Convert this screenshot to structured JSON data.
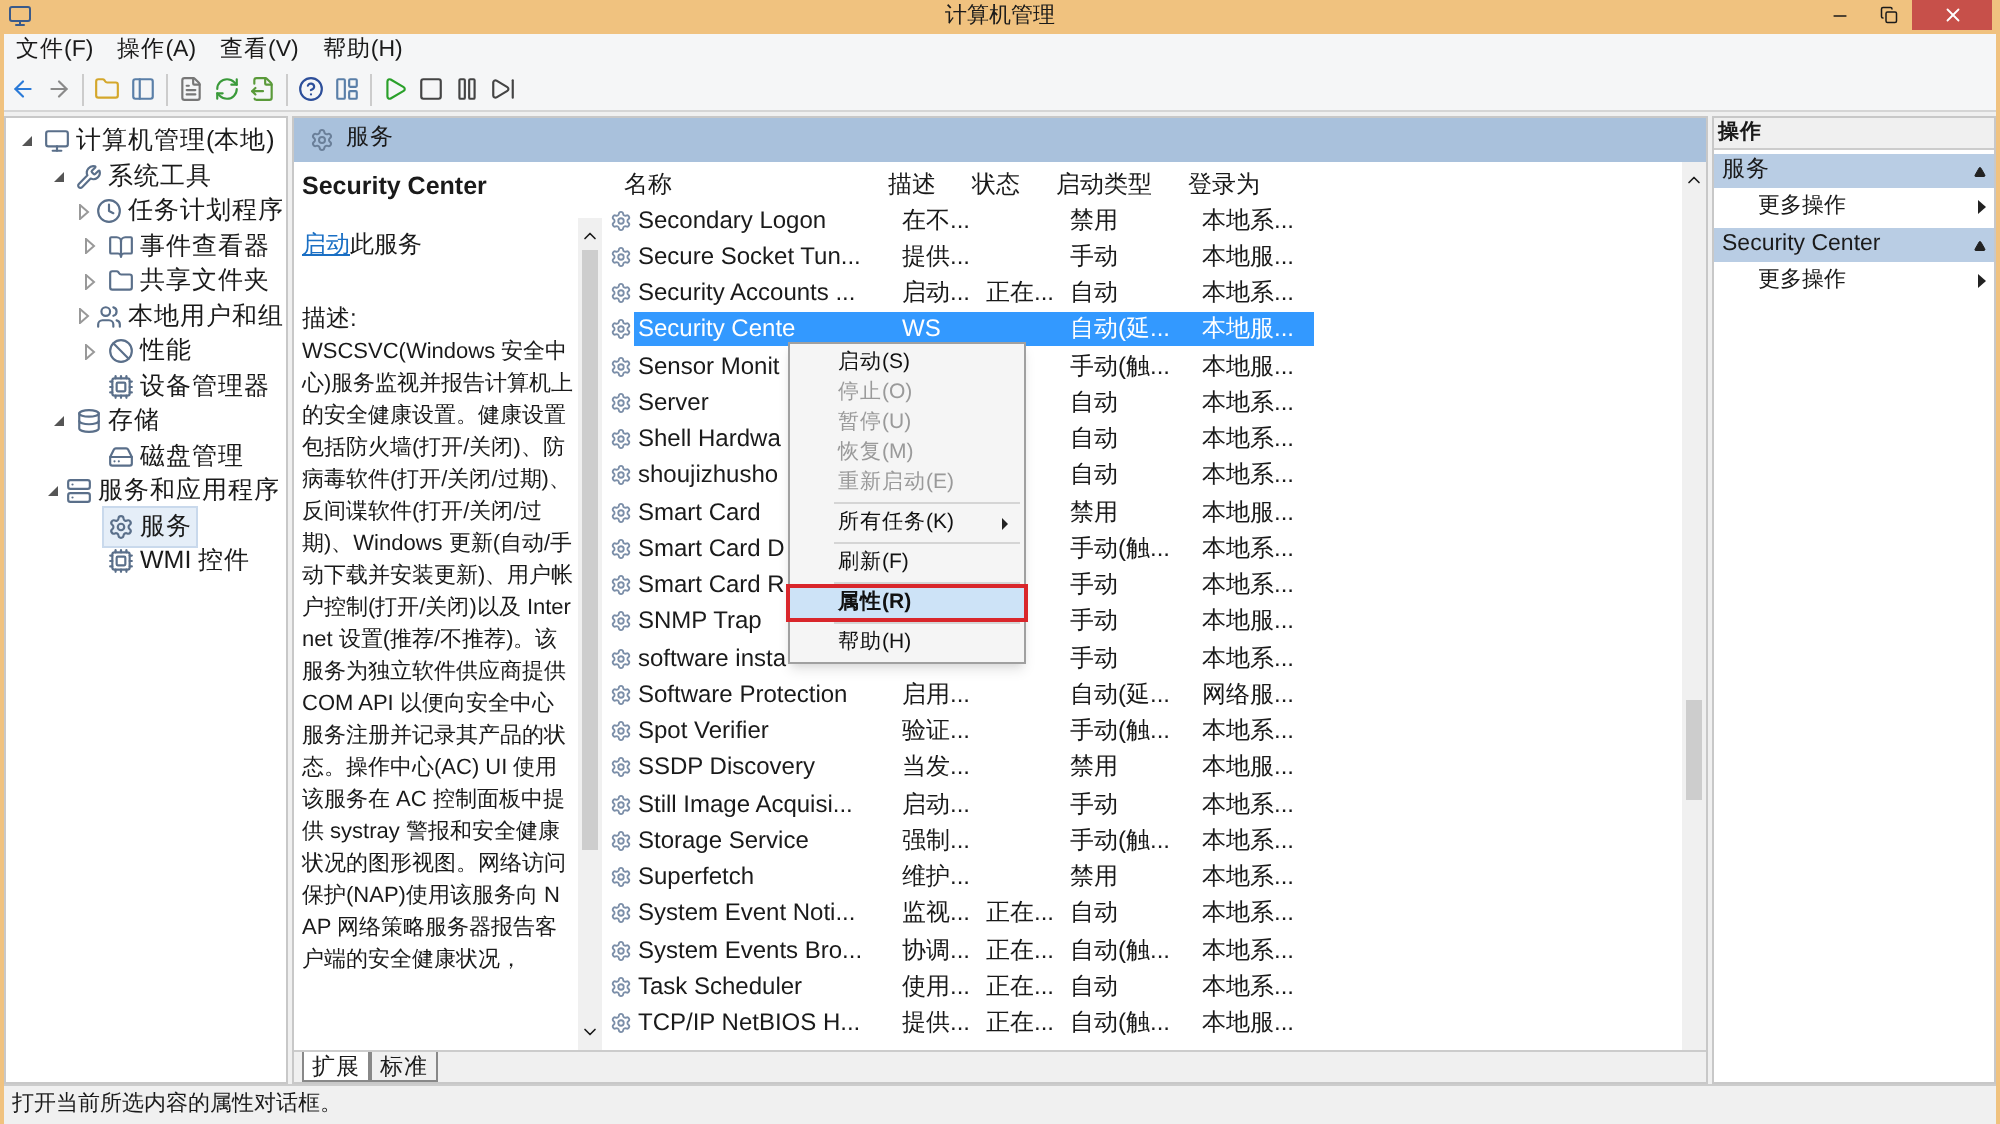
{
  "window": {
    "title": "计算机管理"
  },
  "menu": [
    "文件(F)",
    "操作(A)",
    "查看(V)",
    "帮助(H)"
  ],
  "tree": [
    {
      "label": "计算机管理(本地)",
      "expanded": true,
      "selected": false,
      "children": [
        {
          "label": "系统工具",
          "expanded": true,
          "selected": false,
          "children": [
            {
              "label": "任务计划程序",
              "expanded": false,
              "selected": false
            },
            {
              "label": "事件查看器",
              "expanded": false,
              "selected": false
            },
            {
              "label": "共享文件夹",
              "expanded": false,
              "selected": false
            },
            {
              "label": "本地用户和组",
              "expanded": false,
              "selected": false
            },
            {
              "label": "性能",
              "expanded": false,
              "selected": false
            },
            {
              "label": "设备管理器",
              "selected": false
            }
          ]
        },
        {
          "label": "存储",
          "expanded": true,
          "selected": false,
          "children": [
            {
              "label": "磁盘管理",
              "selected": false
            }
          ]
        },
        {
          "label": "服务和应用程序",
          "expanded": true,
          "selected": false,
          "children": [
            {
              "label": "服务",
              "selected": true
            },
            {
              "label": "WMI 控件",
              "selected": false
            }
          ]
        }
      ]
    }
  ],
  "panel": {
    "title": "服务"
  },
  "details": {
    "name": "Security Center",
    "link": "启动",
    "link_suffix": "此服务",
    "desc_label": "描述:",
    "description": "WSCSVC(Windows 安全中心)服务监视并报告计算机上的安全健康设置。健康设置包括防火墙(打开/关闭)、防病毒软件(打开/关闭/过期)、反间谍软件(打开/关闭/过期)、Windows 更新(自动/手动下载并安装更新)、用户帐户控制(打开/关闭)以及 Internet 设置(推荐/不推荐)。该服务为独立软件供应商提供 COM API 以便向安全中心服务注册并记录其产品的状态。操作中心(AC) UI 使用该服务在 AC 控制面板中提供 systray 警报和安全健康状况的图形视图。网络访问保护(NAP)使用该服务向 NAP 网络策略服务器报告客户端的安全健康状况，"
  },
  "table": {
    "columns": [
      "名称",
      "描述",
      "状态",
      "启动类型",
      "登录为"
    ],
    "rows": [
      {
        "cells": [
          "Secondary Logon",
          "在不...",
          "",
          "禁用",
          "本地系..."
        ],
        "selected": false
      },
      {
        "cells": [
          "Secure Socket Tun...",
          "提供...",
          "",
          "手动",
          "本地服..."
        ],
        "selected": false
      },
      {
        "cells": [
          "Security Accounts ...",
          "启动...",
          "正在...",
          "自动",
          "本地系..."
        ],
        "selected": false
      },
      {
        "cells": [
          "Security Cente",
          "WS",
          "",
          "自动(延...",
          "本地服..."
        ],
        "selected": true
      },
      {
        "cells": [
          "Sensor Monit",
          "",
          "",
          "手动(触...",
          "本地服..."
        ],
        "selected": false
      },
      {
        "cells": [
          "Server",
          "",
          "",
          "自动",
          "本地系..."
        ],
        "selected": false
      },
      {
        "cells": [
          "Shell Hardwa",
          "",
          "",
          "自动",
          "本地系..."
        ],
        "selected": false
      },
      {
        "cells": [
          "shoujizhusho",
          "",
          "",
          "自动",
          "本地系..."
        ],
        "selected": false
      },
      {
        "cells": [
          "Smart Card",
          "",
          "",
          "禁用",
          "本地服..."
        ],
        "selected": false
      },
      {
        "cells": [
          "Smart Card D",
          "",
          "",
          "手动(触...",
          "本地系..."
        ],
        "selected": false
      },
      {
        "cells": [
          "Smart Card R",
          "",
          "",
          "手动",
          "本地系..."
        ],
        "selected": false
      },
      {
        "cells": [
          "SNMP Trap",
          "",
          "",
          "手动",
          "本地服..."
        ],
        "selected": false
      },
      {
        "cells": [
          "software insta",
          "",
          "",
          "手动",
          "本地系..."
        ],
        "selected": false
      },
      {
        "cells": [
          "Software Protection",
          "启用...",
          "",
          "自动(延...",
          "网络服..."
        ],
        "selected": false
      },
      {
        "cells": [
          "Spot Verifier",
          "验证...",
          "",
          "手动(触...",
          "本地系..."
        ],
        "selected": false
      },
      {
        "cells": [
          "SSDP Discovery",
          "当发...",
          "",
          "禁用",
          "本地服..."
        ],
        "selected": false
      },
      {
        "cells": [
          "Still Image Acquisi...",
          "启动...",
          "",
          "手动",
          "本地系..."
        ],
        "selected": false
      },
      {
        "cells": [
          "Storage Service",
          "强制...",
          "",
          "手动(触...",
          "本地系..."
        ],
        "selected": false
      },
      {
        "cells": [
          "Superfetch",
          "维护...",
          "",
          "禁用",
          "本地系..."
        ],
        "selected": false
      },
      {
        "cells": [
          "System Event Noti...",
          "监视...",
          "正在...",
          "自动",
          "本地系..."
        ],
        "selected": false
      },
      {
        "cells": [
          "System Events Bro...",
          "协调...",
          "正在...",
          "自动(触...",
          "本地系..."
        ],
        "selected": false
      },
      {
        "cells": [
          "Task Scheduler",
          "使用...",
          "正在...",
          "自动",
          "本地系..."
        ],
        "selected": false
      },
      {
        "cells": [
          "TCP/IP NetBIOS H...",
          "提供...",
          "正在...",
          "自动(触...",
          "本地服..."
        ],
        "selected": false
      }
    ]
  },
  "context_menu": [
    {
      "kind": "item",
      "label": "启动(S)",
      "disabled": false,
      "selected": false,
      "submenu": false,
      "highlighted": false
    },
    {
      "kind": "item",
      "label": "停止(O)",
      "disabled": true,
      "selected": false,
      "submenu": false,
      "highlighted": false
    },
    {
      "kind": "item",
      "label": "暂停(U)",
      "disabled": true,
      "selected": false,
      "submenu": false,
      "highlighted": false
    },
    {
      "kind": "item",
      "label": "恢复(M)",
      "disabled": true,
      "selected": false,
      "submenu": false,
      "highlighted": false
    },
    {
      "kind": "item",
      "label": "重新启动(E)",
      "disabled": true,
      "selected": false,
      "submenu": false,
      "highlighted": false
    },
    {
      "kind": "separator"
    },
    {
      "kind": "item",
      "label": "所有任务(K)",
      "disabled": false,
      "selected": false,
      "submenu": true,
      "highlighted": false
    },
    {
      "kind": "separator"
    },
    {
      "kind": "item",
      "label": "刷新(F)",
      "disabled": false,
      "selected": false,
      "submenu": false,
      "highlighted": false
    },
    {
      "kind": "separator"
    },
    {
      "kind": "item",
      "label": "属性(R)",
      "disabled": false,
      "selected": true,
      "submenu": false,
      "highlighted": true
    },
    {
      "kind": "separator"
    },
    {
      "kind": "item",
      "label": "帮助(H)",
      "disabled": false,
      "selected": false,
      "submenu": false,
      "highlighted": false
    }
  ],
  "view_tabs": [
    {
      "label": "扩展",
      "selected": true
    },
    {
      "label": "标准",
      "selected": false
    }
  ],
  "actions": {
    "title": "操作",
    "sections": [
      {
        "title": "服务",
        "items": [
          "更多操作"
        ]
      },
      {
        "title": "Security Center",
        "items": [
          "更多操作"
        ]
      }
    ]
  },
  "status_bar": "打开当前所选内容的属性对话框。"
}
